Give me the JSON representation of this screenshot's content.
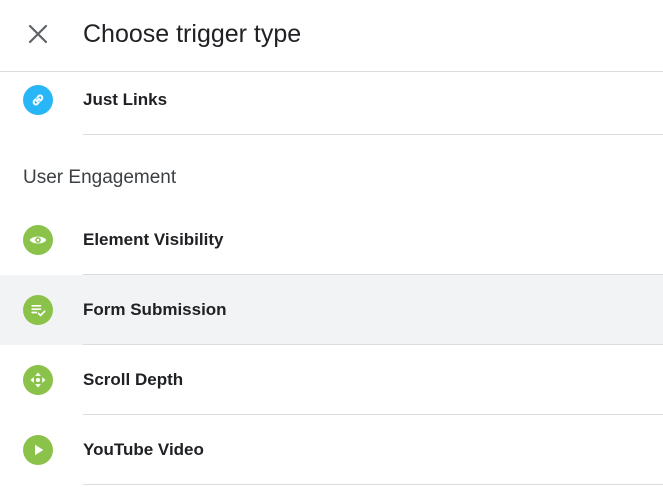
{
  "header": {
    "title": "Choose trigger type",
    "close_icon": "close-icon"
  },
  "colors": {
    "link_blue": "#29b6f6",
    "engagement_green": "#8bc34a",
    "selected_bg": "#f1f3f4",
    "divider": "#dadce0"
  },
  "items_top": [
    {
      "label": "Just Links",
      "icon": "link-icon",
      "color": "#29b6f6"
    }
  ],
  "section": {
    "heading": "User Engagement"
  },
  "engagement_items": [
    {
      "label": "Element Visibility",
      "icon": "eye-icon",
      "color": "#8bc34a",
      "selected": false
    },
    {
      "label": "Form Submission",
      "icon": "form-check-icon",
      "color": "#8bc34a",
      "selected": true
    },
    {
      "label": "Scroll Depth",
      "icon": "move-arrows-icon",
      "color": "#8bc34a",
      "selected": false
    },
    {
      "label": "YouTube Video",
      "icon": "play-icon",
      "color": "#8bc34a",
      "selected": false
    }
  ]
}
